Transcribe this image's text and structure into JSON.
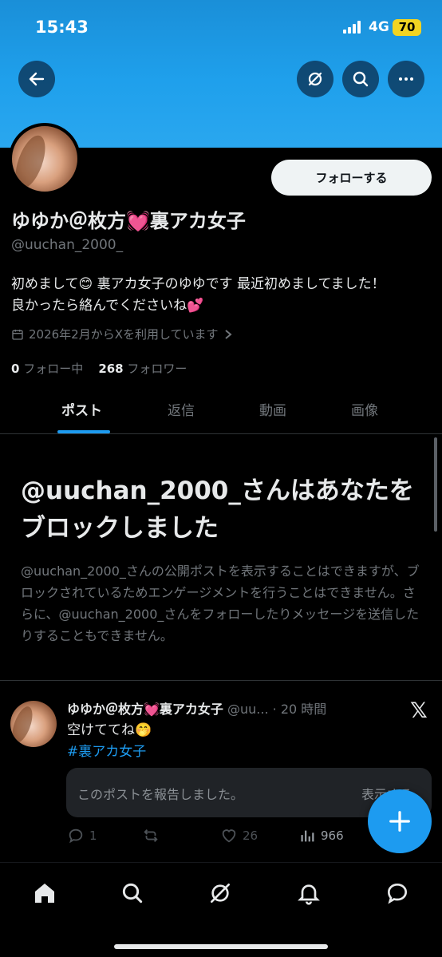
{
  "status_bar": {
    "time": "15:43",
    "network": "4G",
    "battery": "70"
  },
  "header": {
    "back_icon": "arrow-left-icon",
    "grok_icon": "grok-icon",
    "search_icon": "search-icon",
    "more_icon": "more-icon"
  },
  "profile": {
    "display_name": "ゆゆか＠枚方💓裏アカ女子",
    "handle": "@uuchan_2000_",
    "follow_label": "フォローする",
    "bio_line1": "初めまして😊 裏アカ女子のゆゆです 最近初めましてました！",
    "bio_line2": "良かったら絡んでくださいね💕",
    "joined": "2026年2月からXを利用しています",
    "following_count": "0",
    "following_label": "フォロー中",
    "followers_count": "268",
    "followers_label": "フォロワー"
  },
  "tabs": [
    {
      "label": "ポスト"
    },
    {
      "label": "返信"
    },
    {
      "label": "動画"
    },
    {
      "label": "画像"
    }
  ],
  "blocked": {
    "title": "@uuchan_2000_さんはあなたをブロックしました",
    "body": "@uuchan_2000_さんの公開ポストを表示することはできますが、ブロックされているためエンゲージメントを行うことはできません。さらに、@uuchan_2000_さんをフォローしたりメッセージを送信したりすることもできません。"
  },
  "post": {
    "name": "ゆゆか＠枚方💓裏アカ女子",
    "meta": " @uu... · 20 時間",
    "text": "空けててね🤭",
    "hashtag": "#裏アカ女子",
    "report_text": "このポストを報告しました。",
    "report_show": "表示する",
    "replies": "1",
    "likes": "26",
    "views": "966"
  },
  "colors": {
    "accent": "#1d9bf0",
    "banner": "#1fa0ec",
    "background": "#000000"
  },
  "bottom_nav": [
    "home-icon",
    "search-icon",
    "grok-icon",
    "bell-icon",
    "messages-icon"
  ]
}
